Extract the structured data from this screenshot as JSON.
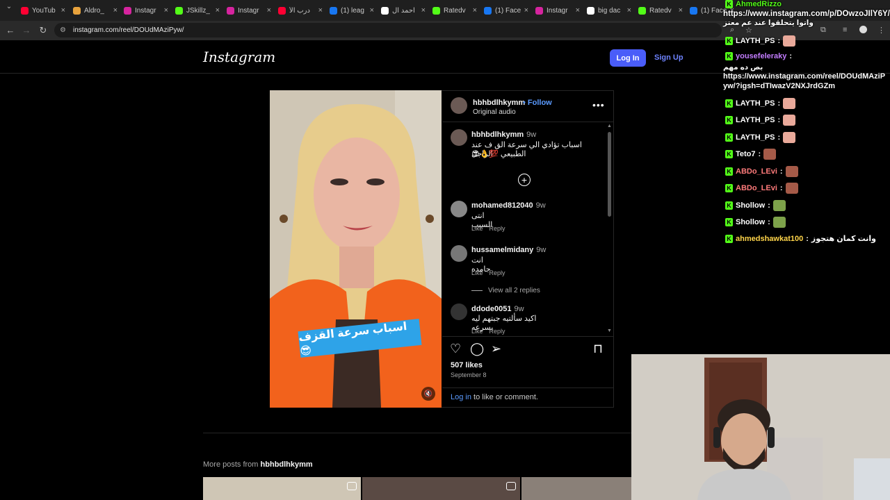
{
  "browser": {
    "tabs": [
      {
        "label": "YouTub",
        "favicon_color": "#ff0033"
      },
      {
        "label": "Aldro_",
        "favicon_color": "#e8a33d"
      },
      {
        "label": "Instagr",
        "favicon_color": "#d6249f"
      },
      {
        "label": "JSkillz_",
        "favicon_color": "#53fc18"
      },
      {
        "label": "Instagr",
        "favicon_color": "#d6249f"
      },
      {
        "label": "درب الأ",
        "favicon_color": "#ff0033"
      },
      {
        "label": "(1) leag",
        "favicon_color": "#1877f2"
      },
      {
        "label": "احمد ال",
        "favicon_color": "#ffffff"
      },
      {
        "label": "Ratedv",
        "favicon_color": "#53fc18"
      },
      {
        "label": "(1) Face",
        "favicon_color": "#1877f2"
      },
      {
        "label": "Instagr",
        "favicon_color": "#d6249f"
      },
      {
        "label": "big dac",
        "favicon_color": "#ffffff"
      },
      {
        "label": "Ratedv",
        "favicon_color": "#53fc18"
      },
      {
        "label": "(1) Face",
        "favicon_color": "#1877f2"
      }
    ],
    "url": "instagram.com/reel/DOUdMAziPyw/"
  },
  "instagram": {
    "logo": "Instagram",
    "login_label": "Log In",
    "signup_label": "Sign Up",
    "post": {
      "author": "hbhbdlhkymm",
      "follow_label": "• Follow",
      "audio": "Original audio",
      "more": "•••",
      "caption": {
        "user": "hbhbdlhkymm",
        "time": "9w",
        "text_line1": "اسباب تؤادي الي سرعة الق ف عند الراجل",
        "text_line2": "الطبيعي 💯👌😎"
      },
      "video_sticker": "اسباب سرعة القزف 😎",
      "comments": [
        {
          "user": "mohamed812040",
          "time": "9w",
          "text": "انتى السبب",
          "like": "Like",
          "reply": "Reply"
        },
        {
          "user": "hussamelmidany",
          "time": "9w",
          "text": "انت جامده",
          "like": "Like",
          "reply": "Reply"
        },
        {
          "user": "ddode0051",
          "time": "9w",
          "text": "اكيد سألتيه جبتهم ليه بسرعه",
          "like": "Like",
          "reply": "Reply"
        }
      ],
      "view_replies": "View all 2 replies",
      "likes": "507 likes",
      "date": "September 8",
      "login_prompt_link": "Log in",
      "login_prompt_rest": " to like or comment."
    },
    "more_posts_prefix": "More posts from ",
    "more_posts_user": "hbhbdlhkymm"
  },
  "stream_chat": {
    "messages": [
      {
        "user": "AhmedRizzo",
        "text": "",
        "user_color": "#53fc18"
      },
      {
        "user": "LAYTH_PS",
        "text": "",
        "user_color": "#ffffff"
      },
      {
        "user": "yousefeleraky",
        "text": "",
        "user_color": "#c37dff"
      },
      {
        "user": "LAYTH_PS",
        "text": "",
        "user_color": "#ffffff"
      },
      {
        "user": "LAYTH_PS",
        "text": "",
        "user_color": "#ffffff"
      },
      {
        "user": "LAYTH_PS",
        "text": "",
        "user_color": "#ffffff"
      },
      {
        "user": "Teto7",
        "text": "",
        "user_color": "#ffffff"
      },
      {
        "user": "ABDo_LEvi",
        "text": "",
        "user_color": "#ff7b7b"
      },
      {
        "user": "ABDo_LEvi",
        "text": "",
        "user_color": "#ff7b7b"
      },
      {
        "user": "Shollow",
        "text": "",
        "user_color": "#ffffff"
      },
      {
        "user": "Shollow",
        "text": "",
        "user_color": "#ffffff"
      },
      {
        "user": "ahmedshawkat100",
        "text": "وانت كمان هتجوز",
        "user_color": "#ffd54a"
      }
    ],
    "rizzo_line1": "https://www.instagram.com/p/DOwzoJIlY6Y/",
    "rizzo_line2": "واتوا يتحلقوا عند عم معتز",
    "yousef_line1": "بص ده مهم",
    "yousef_line2": "https://www.instagram.com/reel/DOUdMAziP",
    "yousef_line3": "yw/?igsh=dTIwazV2NXJrdGZm"
  }
}
